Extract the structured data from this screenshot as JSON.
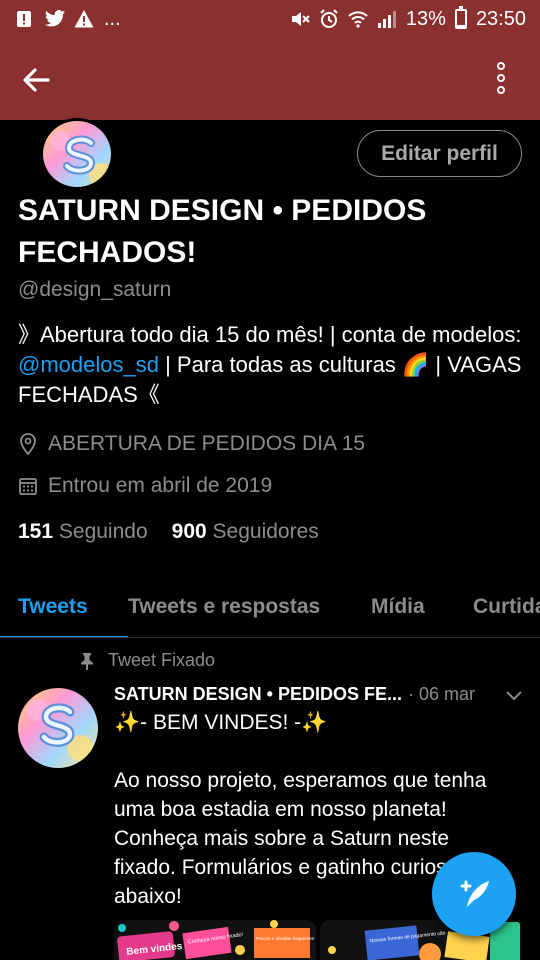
{
  "status_bar": {
    "left_icons": [
      "alert-icon",
      "twitter-icon",
      "warning-icon"
    ],
    "overflow": "...",
    "right_icons": [
      "mute-icon",
      "alarm-icon",
      "wifi-icon",
      "signal-icon"
    ],
    "battery_level": 0.13,
    "battery": "13%",
    "time": "23:50",
    "color": "#8a302f"
  },
  "app_bar": {
    "back_icon": "arrow-left-icon",
    "menu_icon": "more-vertical-icon"
  },
  "profile": {
    "edit_button": "Editar perfil",
    "name": "SATURN DESIGN • PEDIDOS FECHADOS!",
    "handle": "@design_saturn",
    "bio_part1": "》Abertura todo dia 15 do mês! | conta de modelos: ",
    "bio_mention": "@modelos_sd",
    "bio_part2": " | Para todas as culturas 🌈 | VAGAS FECHADAS《",
    "location": "ABERTURA DE PEDIDOS DIA 15",
    "joined": "Entrou em abril de 2019",
    "following_count": "151",
    "following_label": "Seguindo",
    "followers_count": "900",
    "followers_label": "Seguidores"
  },
  "tabs": [
    {
      "label": "Tweets",
      "active": true
    },
    {
      "label": "Tweets e respostas",
      "active": false
    },
    {
      "label": "Mídia",
      "active": false
    },
    {
      "label": "Curtidas",
      "active": false
    }
  ],
  "tweet": {
    "pinned_label": "Tweet Fixado",
    "name": "SATURN DESIGN • PEDIDOS FE...",
    "date": "· 06 mar",
    "text": "✨- BEM VINDES! -✨\n\nAo nosso projeto, esperamos que tenha uma boa estadia em nosso planeta! Conheça mais sobre a Saturn neste fixado. Formulários e gatinho curioso logo abaixo!",
    "media": [
      {
        "labels": [
          "Bem vindes",
          "Conheça nosso fixado!",
          "Preços e dúvidas frequentes"
        ]
      },
      {
        "labels": [
          "Nossas formas de pagamento são"
        ]
      }
    ]
  },
  "colors": {
    "accent": "#1da1f2",
    "header": "#8a302f",
    "muted": "#8c8c8c",
    "background": "#000000"
  }
}
